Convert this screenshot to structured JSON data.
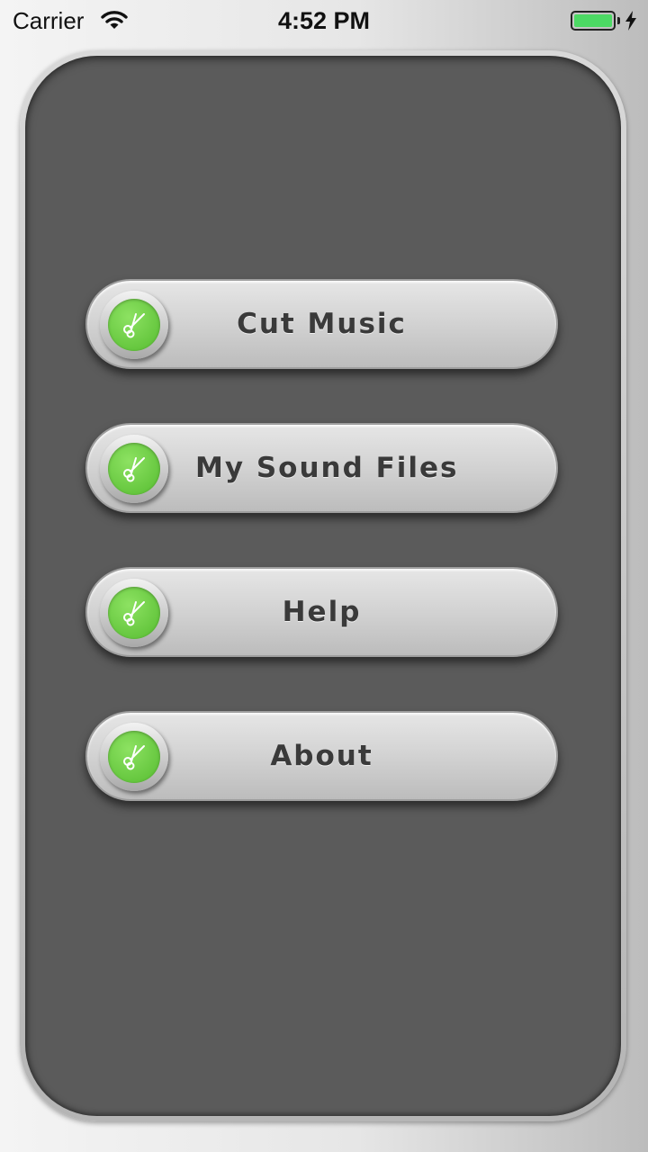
{
  "status_bar": {
    "carrier": "Carrier",
    "time": "4:52 PM",
    "battery_color": "#4cd964"
  },
  "colors": {
    "panel": "#5b5b5b",
    "button_text": "#3a3a3a",
    "icon_green": "#63c53c"
  },
  "menu": {
    "items": [
      {
        "label": "Cut Music",
        "icon": "scissors-icon"
      },
      {
        "label": "My Sound Files",
        "icon": "scissors-icon"
      },
      {
        "label": "Help",
        "icon": "scissors-icon"
      },
      {
        "label": "About",
        "icon": "scissors-icon"
      }
    ]
  }
}
